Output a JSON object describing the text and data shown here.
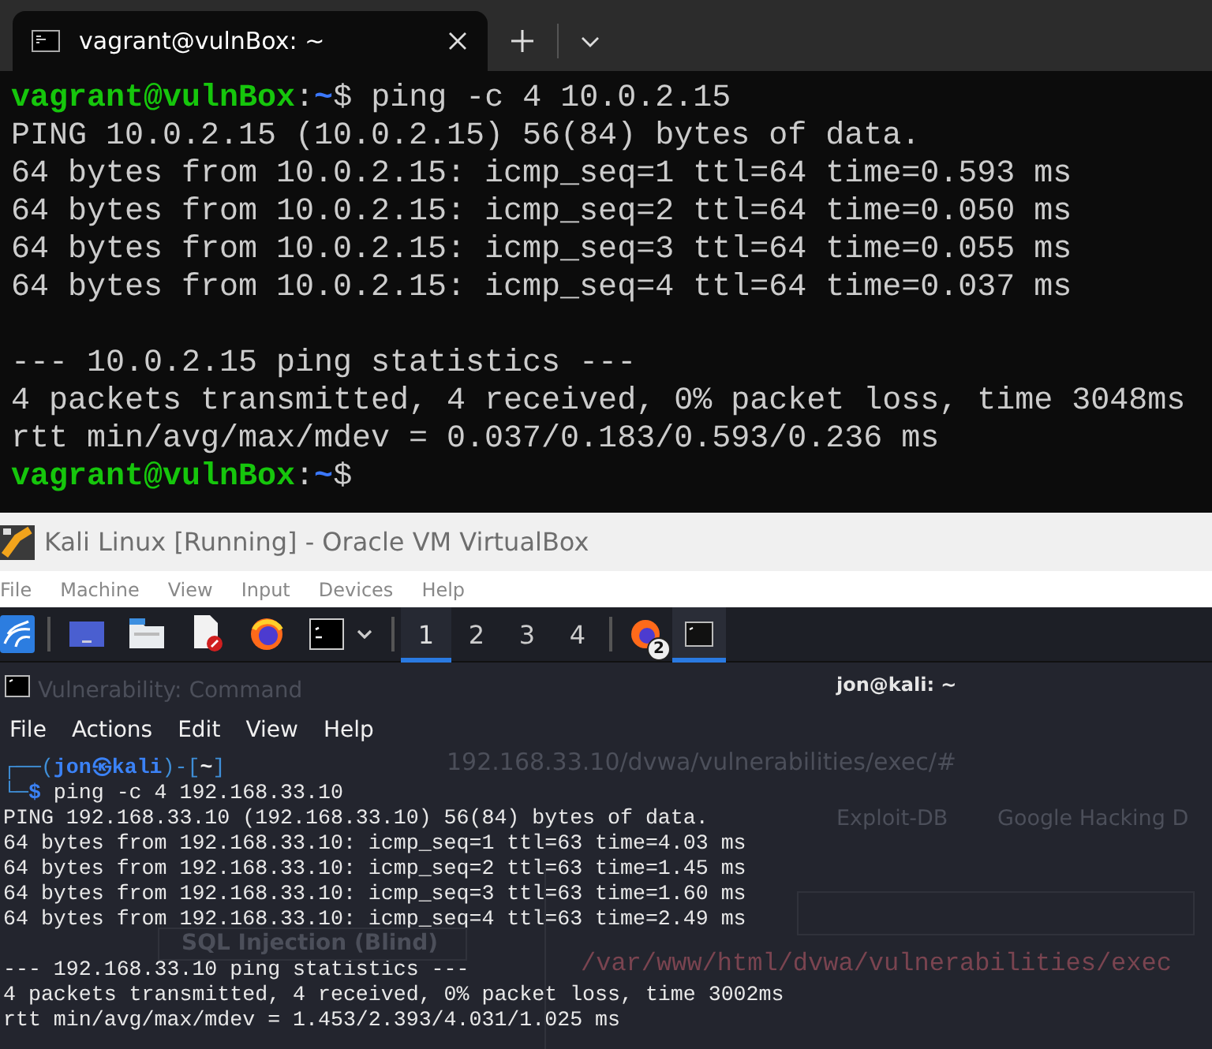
{
  "host_terminal": {
    "tabs": [
      {
        "title": "vagrant@vulnBox: ~",
        "selected": true
      }
    ],
    "lines": [
      {
        "kind": "text",
        "segments": [
          {
            "kind": "user",
            "text": "vagrant@vulnBox"
          },
          {
            "kind": "plain",
            "text": ":"
          },
          {
            "kind": "path",
            "text": "~"
          },
          {
            "kind": "plain",
            "text": "$ ping -c 4 10.0.2.15"
          }
        ]
      },
      {
        "kind": "text",
        "segments": [
          {
            "kind": "plain",
            "text": "PING 10.0.2.15 (10.0.2.15) 56(84) bytes of data."
          }
        ]
      },
      {
        "kind": "text",
        "segments": [
          {
            "kind": "plain",
            "text": "64 bytes from 10.0.2.15: icmp_seq=1 ttl=64 time=0.593 ms"
          }
        ]
      },
      {
        "kind": "text",
        "segments": [
          {
            "kind": "plain",
            "text": "64 bytes from 10.0.2.15: icmp_seq=2 ttl=64 time=0.050 ms"
          }
        ]
      },
      {
        "kind": "text",
        "segments": [
          {
            "kind": "plain",
            "text": "64 bytes from 10.0.2.15: icmp_seq=3 ttl=64 time=0.055 ms"
          }
        ]
      },
      {
        "kind": "text",
        "segments": [
          {
            "kind": "plain",
            "text": "64 bytes from 10.0.2.15: icmp_seq=4 ttl=64 time=0.037 ms"
          }
        ]
      },
      {
        "kind": "blank"
      },
      {
        "kind": "text",
        "segments": [
          {
            "kind": "plain",
            "text": "--- 10.0.2.15 ping statistics ---"
          }
        ]
      },
      {
        "kind": "text",
        "segments": [
          {
            "kind": "plain",
            "text": "4 packets transmitted, 4 received, 0% packet loss, time 3048ms"
          }
        ]
      },
      {
        "kind": "text",
        "segments": [
          {
            "kind": "plain",
            "text": "rtt min/avg/max/mdev = 0.037/0.183/0.593/0.236 ms"
          }
        ]
      },
      {
        "kind": "text",
        "segments": [
          {
            "kind": "user",
            "text": "vagrant@vulnBox"
          },
          {
            "kind": "plain",
            "text": ":"
          },
          {
            "kind": "path",
            "text": "~"
          },
          {
            "kind": "plain",
            "text": "$"
          }
        ]
      }
    ]
  },
  "vm_window": {
    "title": "Kali Linux [Running] - Oracle VM VirtualBox",
    "menu": [
      "File",
      "Machine",
      "View",
      "Input",
      "Devices",
      "Help"
    ],
    "panel": {
      "workspaces": [
        {
          "label": "1",
          "selected": true
        },
        {
          "label": "2",
          "selected": false
        },
        {
          "label": "3",
          "selected": false
        },
        {
          "label": "4",
          "selected": false
        }
      ],
      "tasks": [
        {
          "kind": "browser",
          "badge": "2",
          "selected": false
        },
        {
          "kind": "terminal",
          "selected": true
        }
      ]
    },
    "background_browser": {
      "tab_title": "Vulnerability: Command",
      "url": "192.168.33.10/dvwa/vulnerabilities/exec/#",
      "bookmarks": [
        "Exploit-DB",
        "Google Hacking D"
      ],
      "sidebar_item": "SQL Injection (Blind)",
      "output_line": "/var/www/html/dvwa/vulnerabilities/exec"
    },
    "terminal": {
      "title": "jon@kali: ~",
      "menu": [
        "File",
        "Actions",
        "Edit",
        "View",
        "Help"
      ],
      "lines": [
        {
          "kind": "text",
          "segments": [
            {
              "kind": "frame",
              "text": "┌──("
            },
            {
              "kind": "user",
              "text": "jon㉿kali"
            },
            {
              "kind": "frame",
              "text": ")-["
            },
            {
              "kind": "path",
              "text": "~"
            },
            {
              "kind": "frame",
              "text": "]"
            }
          ]
        },
        {
          "kind": "text",
          "segments": [
            {
              "kind": "frame",
              "text": "└─"
            },
            {
              "kind": "symbol",
              "text": "$"
            },
            {
              "kind": "plain",
              "text": " ping -c 4 192.168.33.10"
            }
          ]
        },
        {
          "kind": "text",
          "segments": [
            {
              "kind": "plain",
              "text": "PING 192.168.33.10 (192.168.33.10) 56(84) bytes of data."
            }
          ]
        },
        {
          "kind": "text",
          "segments": [
            {
              "kind": "plain",
              "text": "64 bytes from 192.168.33.10: icmp_seq=1 ttl=63 time=4.03 ms"
            }
          ]
        },
        {
          "kind": "text",
          "segments": [
            {
              "kind": "plain",
              "text": "64 bytes from 192.168.33.10: icmp_seq=2 ttl=63 time=1.45 ms"
            }
          ]
        },
        {
          "kind": "text",
          "segments": [
            {
              "kind": "plain",
              "text": "64 bytes from 192.168.33.10: icmp_seq=3 ttl=63 time=1.60 ms"
            }
          ]
        },
        {
          "kind": "text",
          "segments": [
            {
              "kind": "plain",
              "text": "64 bytes from 192.168.33.10: icmp_seq=4 ttl=63 time=2.49 ms"
            }
          ]
        },
        {
          "kind": "blank"
        },
        {
          "kind": "text",
          "segments": [
            {
              "kind": "plain",
              "text": "--- 192.168.33.10 ping statistics ---"
            }
          ]
        },
        {
          "kind": "text",
          "segments": [
            {
              "kind": "plain",
              "text": "4 packets transmitted, 4 received, 0% packet loss, time 3002ms"
            }
          ]
        },
        {
          "kind": "text",
          "segments": [
            {
              "kind": "plain",
              "text": "rtt min/avg/max/mdev = 1.453/2.393/4.031/1.025 ms"
            }
          ]
        }
      ]
    }
  }
}
